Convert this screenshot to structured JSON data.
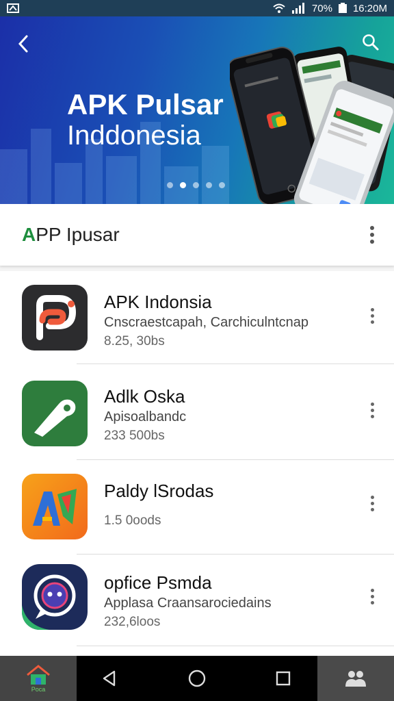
{
  "status_bar": {
    "battery": "70%",
    "time": "16:20M"
  },
  "hero": {
    "title": "APK Pulsar",
    "subtitle": "Inddonesia",
    "dots_count": 5,
    "active_dot": 1
  },
  "section": {
    "title_accent": "A",
    "title_rest": "PP Ipusar"
  },
  "apps": [
    {
      "name": "APK Indonsia",
      "desc": "Cnscraestcapah, Carchiculntcnap",
      "size": "8.25, 30bs",
      "icon": "pulsar-p-icon"
    },
    {
      "name": "Adlk Oska",
      "desc": "Apisoalbandc",
      "size": "233 500bs",
      "icon": "tag-icon"
    },
    {
      "name": "Paldy lSrodas",
      "desc": "",
      "size": "1.5 0oods",
      "icon": "colorful-a-icon"
    },
    {
      "name": "opfice Psmda",
      "desc": "Applasa Craansarociedains",
      "size": "232,6loos",
      "icon": "chat-face-icon"
    }
  ],
  "navbar": {
    "home_label": "Poca"
  },
  "colors": {
    "accent": "#1e8e3e",
    "status_bar": "#1f3f57",
    "hero_start": "#1b2fa8",
    "hero_end": "#1bb79a"
  }
}
